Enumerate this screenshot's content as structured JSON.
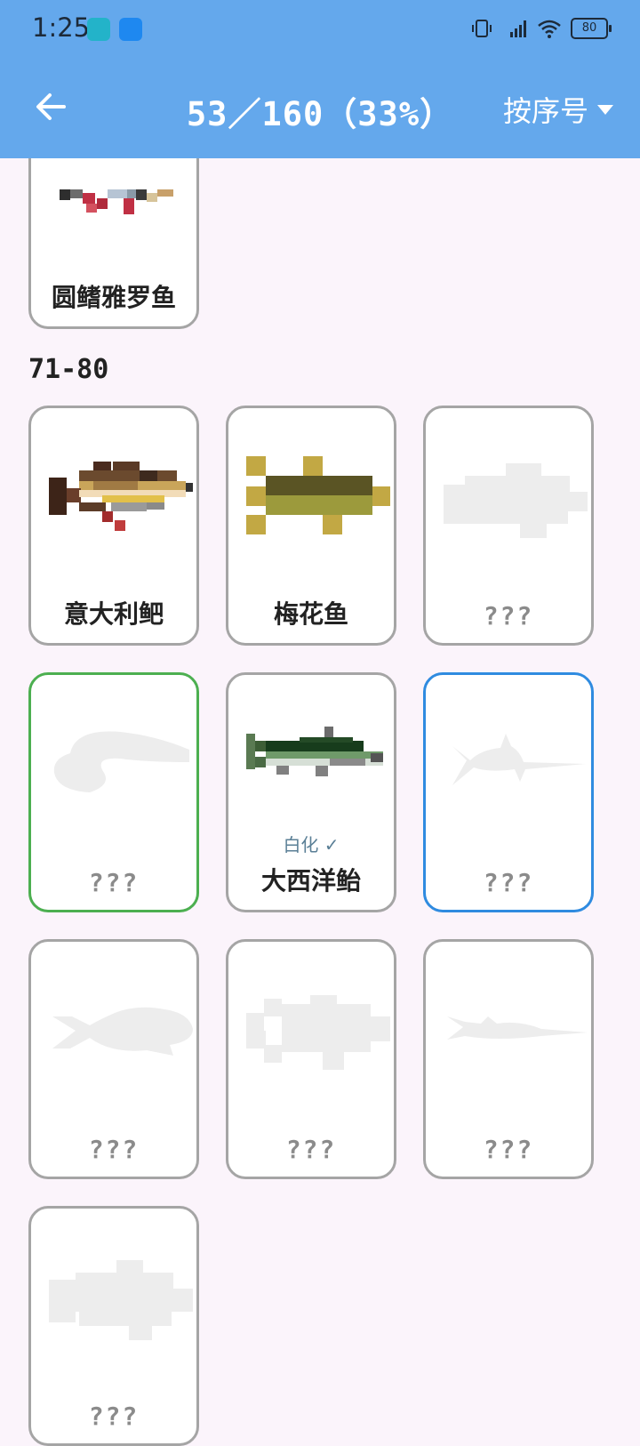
{
  "status": {
    "time": "1:25",
    "battery": "80"
  },
  "header": {
    "title": "53／160（33%）",
    "sort_label": "按序号"
  },
  "sections": [
    {
      "label": "71-80"
    }
  ],
  "cards": [
    {
      "name": "圆鳍雅罗鱼",
      "fish": "rudd"
    },
    {
      "name": "意大利鲃",
      "fish": "barbel"
    },
    {
      "name": "梅花鱼",
      "fish": "yellowfish"
    },
    {
      "name": "???",
      "fish": "unknown-sil"
    },
    {
      "name": "???",
      "fish": "unknown-sil",
      "state": "selected-green"
    },
    {
      "name": "大西洋鲐",
      "fish": "mackerel",
      "badge": "白化 ✓"
    },
    {
      "name": "???",
      "fish": "swordfish-sil",
      "state": "selected-blue"
    },
    {
      "name": "???",
      "fish": "unknown-sil"
    },
    {
      "name": "???",
      "fish": "unknown-sil"
    },
    {
      "name": "???",
      "fish": "needle-sil"
    },
    {
      "name": "???",
      "fish": "unknown-sil"
    }
  ],
  "colors": {
    "topbar": "#64A8EC",
    "background": "#FBF4FB",
    "green": "#4CAF50",
    "blue": "#2F8BE0"
  }
}
